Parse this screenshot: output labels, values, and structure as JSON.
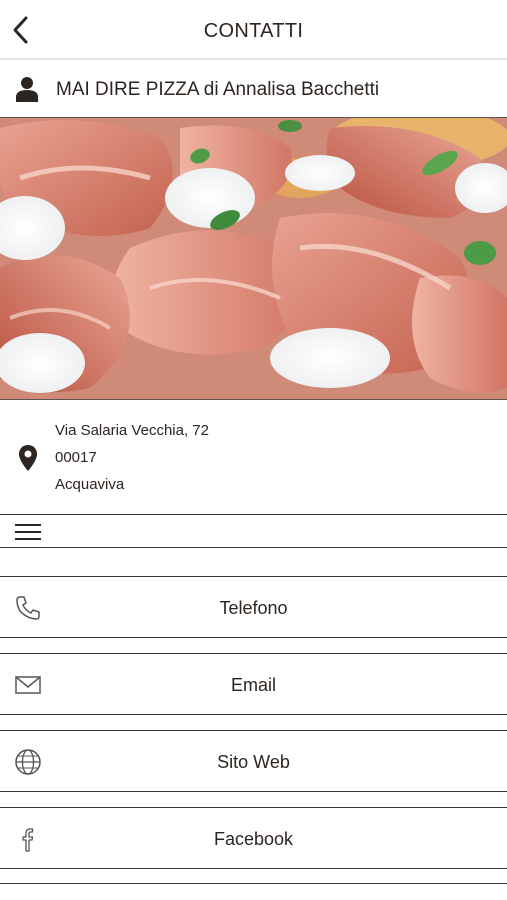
{
  "header": {
    "title": "CONTATTI",
    "back_icon": "chevron-left-icon"
  },
  "business": {
    "name": "MAI DIRE PIZZA di Annalisa Bacchetti",
    "icon": "person-icon"
  },
  "hero": {
    "subject": "pizza-with-prosciutto-and-burrata"
  },
  "address": {
    "icon": "map-pin-icon",
    "street": "Via Salaria Vecchia, 72",
    "postal_code": "00017",
    "city": "Acquaviva"
  },
  "menu": {
    "icon": "hamburger-menu-icon"
  },
  "actions": [
    {
      "label": "Telefono",
      "icon": "phone-icon"
    },
    {
      "label": "Email",
      "icon": "envelope-icon"
    },
    {
      "label": "Sito Web",
      "icon": "globe-icon"
    },
    {
      "label": "Facebook",
      "icon": "facebook-icon"
    }
  ],
  "colors": {
    "text": "#2d2520",
    "divider": "#3a3530",
    "background": "#ffffff"
  }
}
